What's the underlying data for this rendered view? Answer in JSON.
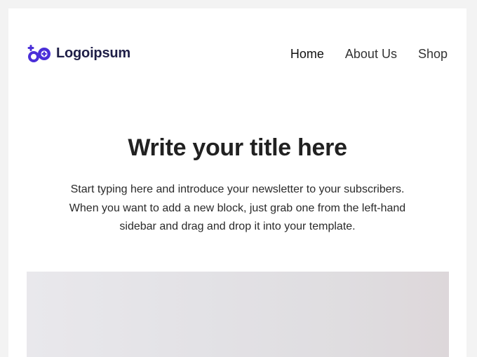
{
  "header": {
    "logo": {
      "text": "Logoipsum",
      "icon": "logoipsum-mark-icon",
      "color": "#4a2fd8"
    },
    "nav": [
      {
        "label": "Home",
        "active": true
      },
      {
        "label": "About Us",
        "active": false
      },
      {
        "label": "Shop",
        "active": false
      }
    ]
  },
  "content": {
    "title": "Write your title here",
    "intro_lines": [
      "Start typing here and introduce your newsletter to your subscribers.",
      "When you want to add a new block, just grab one from the left-hand",
      "sidebar and drag and drop it into your template."
    ]
  },
  "colors": {
    "page_background": "#f3f3f3",
    "card_background": "#ffffff",
    "brand": "#4a2fd8",
    "text": "#212121"
  }
}
